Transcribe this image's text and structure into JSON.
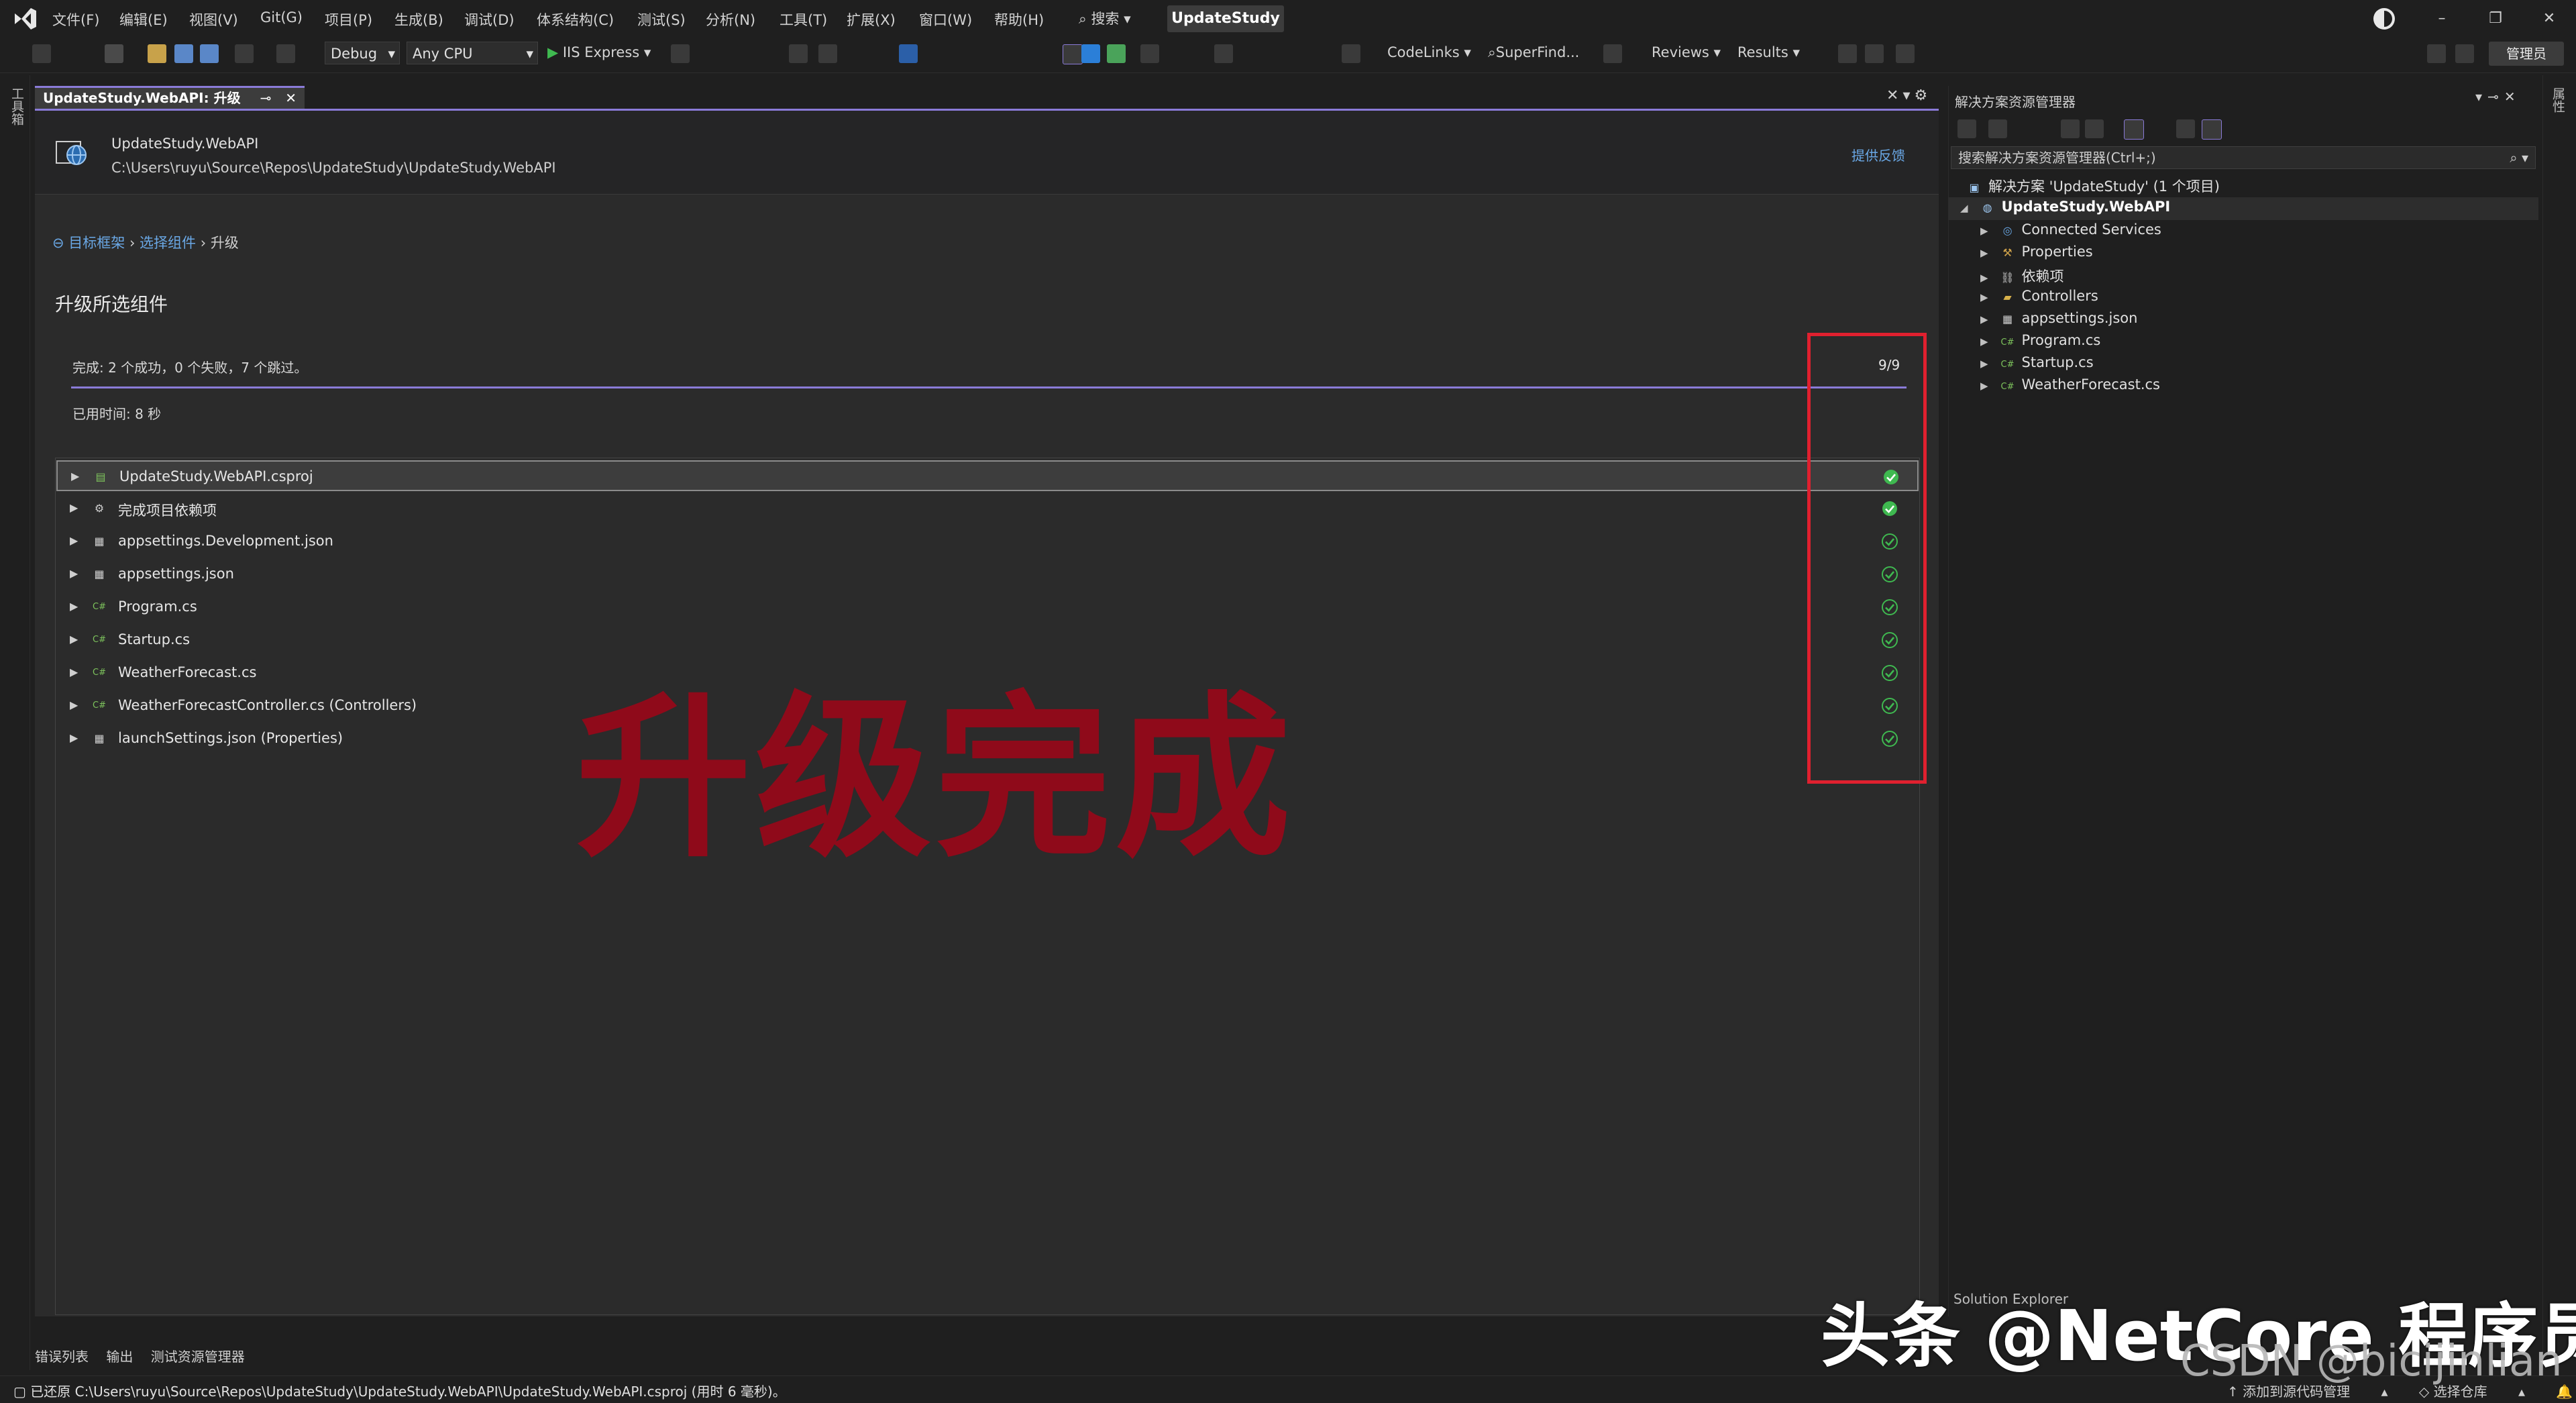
{
  "menu": {
    "items": [
      "文件(F)",
      "编辑(E)",
      "视图(V)",
      "Git(G)",
      "项目(P)",
      "生成(B)",
      "调试(D)",
      "体系结构(C)",
      "测试(S)",
      "分析(N)",
      "工具(T)",
      "扩展(X)",
      "窗口(W)",
      "帮助(H)"
    ],
    "search_label": "搜索",
    "solution_title": "UpdateStudy"
  },
  "toolbar": {
    "config": "Debug",
    "platform": "Any CPU",
    "run_label": "IIS Express",
    "codelinks": "CodeLinks",
    "superfind": "SuperFind...",
    "reviews": "Reviews",
    "results": "Results",
    "admin": "管理员"
  },
  "left_sidebar": {
    "label": "工具箱"
  },
  "right_sidebar": {
    "label": "属性"
  },
  "doc_tab": {
    "title": "UpdateStudy.WebAPI: 升级"
  },
  "header": {
    "project_name": "UpdateStudy.WebAPI",
    "project_path": "C:\\Users\\ruyu\\Source\\Repos\\UpdateStudy\\UpdateStudy.WebAPI",
    "feedback": "提供反馈"
  },
  "breadcrumb": {
    "step1": "目标框架",
    "step2": "选择组件",
    "step3": "升级"
  },
  "page_title": "升级所选组件",
  "progress": {
    "status": "完成: 2 个成功，0 个失败，7 个跳过。",
    "count": "9/9",
    "fraction": 1.0,
    "elapsed": "已用时间: 8 秒"
  },
  "items": [
    {
      "label": "UpdateStudy.WebAPI.csproj",
      "icon": "csproj-icon",
      "status": "success"
    },
    {
      "label": "完成项目依赖项",
      "icon": "gear-icon",
      "status": "success"
    },
    {
      "label": "appsettings.Development.json",
      "icon": "json-icon",
      "status": "skipped"
    },
    {
      "label": "appsettings.json",
      "icon": "json-icon",
      "status": "skipped"
    },
    {
      "label": "Program.cs",
      "icon": "csharp-icon",
      "status": "skipped"
    },
    {
      "label": "Startup.cs",
      "icon": "csharp-icon",
      "status": "skipped"
    },
    {
      "label": "WeatherForecast.cs",
      "icon": "csharp-icon",
      "status": "skipped"
    },
    {
      "label": "WeatherForecastController.cs (Controllers)",
      "icon": "csharp-icon",
      "status": "skipped"
    },
    {
      "label": "launchSettings.json (Properties)",
      "icon": "json-icon",
      "status": "skipped"
    }
  ],
  "overlay": {
    "big_text": "升级完成"
  },
  "solution_explorer": {
    "title": "解决方案资源管理器",
    "search_placeholder": "搜索解决方案资源管理器(Ctrl+;)",
    "solution": "解决方案 'UpdateStudy' (1 个项目)",
    "project": "UpdateStudy.WebAPI",
    "children": [
      {
        "label": "Connected Services",
        "icon": "connected-services-icon"
      },
      {
        "label": "Properties",
        "icon": "wrench-icon"
      },
      {
        "label": "依赖项",
        "icon": "dependencies-icon"
      },
      {
        "label": "Controllers",
        "icon": "folder-icon"
      },
      {
        "label": "appsettings.json",
        "icon": "json-icon"
      },
      {
        "label": "Program.cs",
        "icon": "csharp-icon"
      },
      {
        "label": "Startup.cs",
        "icon": "csharp-icon"
      },
      {
        "label": "WeatherForecast.cs",
        "icon": "csharp-icon"
      }
    ],
    "bottom_notice": "Solution Explorer"
  },
  "bottom_tabs": [
    "错误列表",
    "输出",
    "测试资源管理器"
  ],
  "statusbar": {
    "text": "已还原 C:\\Users\\ruyu\\Source\\Repos\\UpdateStudy\\UpdateStudy.WebAPI\\UpdateStudy.WebAPI.csproj (用时 6 毫秒)。",
    "source_control": "添加到源代码管理",
    "repo": "选择仓库"
  },
  "watermark": {
    "line1": "头条 @NetCore 程序员",
    "line2": "CSDN @bicijinlian"
  },
  "colors": {
    "accent": "#8a7bd8",
    "success": "#3fb950",
    "highlight_box": "#e0202f",
    "overlay_text": "#8f0a1a"
  }
}
